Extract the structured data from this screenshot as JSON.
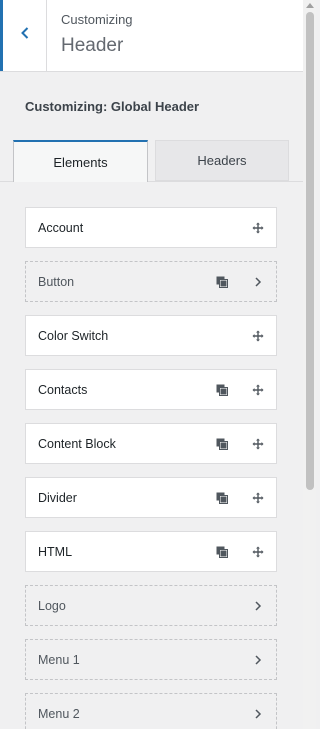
{
  "header": {
    "small": "Customizing",
    "title": "Header"
  },
  "section": {
    "title": "Customizing: Global Header"
  },
  "tabs": [
    {
      "label": "Elements",
      "active": true
    },
    {
      "label": "Headers",
      "active": false
    }
  ],
  "items": [
    {
      "label": "Account",
      "style": "solid",
      "icons": [
        "move-icon"
      ]
    },
    {
      "label": "Button",
      "style": "dashed",
      "icons": [
        "duplicate-icon",
        "chevron-right-icon"
      ]
    },
    {
      "label": "Color Switch",
      "style": "solid",
      "icons": [
        "move-icon"
      ]
    },
    {
      "label": "Contacts",
      "style": "solid",
      "icons": [
        "duplicate-icon",
        "move-icon"
      ]
    },
    {
      "label": "Content Block",
      "style": "solid",
      "icons": [
        "duplicate-icon",
        "move-icon"
      ]
    },
    {
      "label": "Divider",
      "style": "solid",
      "icons": [
        "duplicate-icon",
        "move-icon"
      ]
    },
    {
      "label": "HTML",
      "style": "solid",
      "icons": [
        "duplicate-icon",
        "move-icon"
      ]
    },
    {
      "label": "Logo",
      "style": "dashed",
      "icons": [
        "chevron-right-icon"
      ]
    },
    {
      "label": "Menu 1",
      "style": "dashed",
      "icons": [
        "chevron-right-icon"
      ]
    },
    {
      "label": "Menu 2",
      "style": "dashed",
      "icons": [
        "chevron-right-icon"
      ]
    }
  ],
  "colors": {
    "accent": "#2271b1",
    "panel_bg": "#f0f0f1"
  }
}
